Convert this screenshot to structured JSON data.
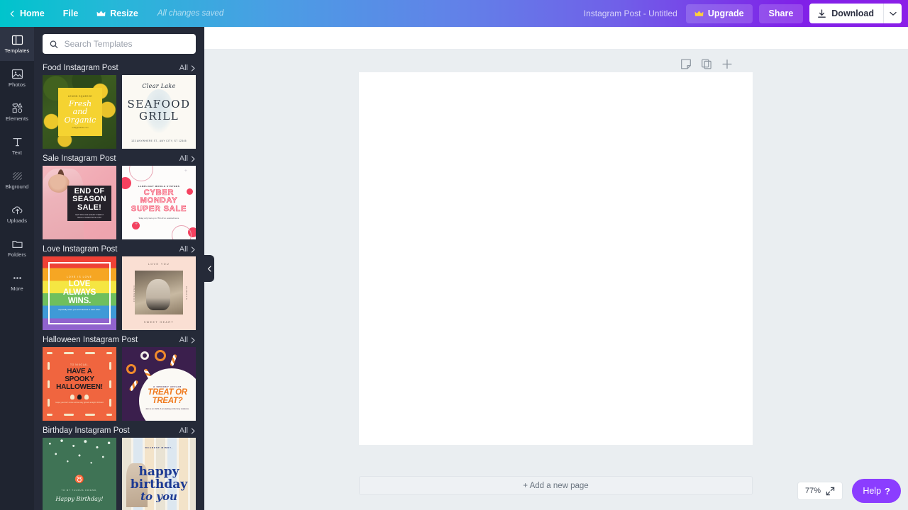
{
  "header": {
    "home_label": "Home",
    "file_label": "File",
    "resize_label": "Resize",
    "saved_status": "All changes saved",
    "doc_title": "Instagram Post - Untitled",
    "upgrade_label": "Upgrade",
    "share_label": "Share",
    "download_label": "Download",
    "gradient_start": "#00c4cc",
    "gradient_end": "#8b1fe8"
  },
  "rail": {
    "items": [
      {
        "label": "Templates",
        "icon": "templates-icon",
        "active": true
      },
      {
        "label": "Photos",
        "icon": "photos-icon",
        "active": false
      },
      {
        "label": "Elements",
        "icon": "elements-icon",
        "active": false
      },
      {
        "label": "Text",
        "icon": "text-icon",
        "active": false
      },
      {
        "label": "Bkground",
        "icon": "background-icon",
        "active": false
      },
      {
        "label": "Uploads",
        "icon": "uploads-icon",
        "active": false
      },
      {
        "label": "Folders",
        "icon": "folders-icon",
        "active": false
      },
      {
        "label": "More",
        "icon": "more-icon",
        "active": false
      }
    ]
  },
  "panel": {
    "search_placeholder": "Search Templates",
    "search_value": "",
    "all_label": "All",
    "sections": [
      {
        "title": "Food Instagram Post",
        "templates": [
          {
            "name": "fresh-and-organic",
            "kicker": "LEMON SQUEEZE",
            "title": "Fresh and Organic",
            "footer": "reallygreatsite.com"
          },
          {
            "name": "seafood-grill",
            "brand": "Clear Lake",
            "line1": "SEAFOOD",
            "line2": "GRILL",
            "address": "123 ANYWHERE ST., ANY CITY, ST 12345"
          }
        ]
      },
      {
        "title": "Sale Instagram Post",
        "templates": [
          {
            "name": "end-of-season-sale",
            "title": "END OF SEASON SALE!",
            "subtitle": "GET 50% OFF EVERY ITEM AT REALLYGREATSITE.COM"
          },
          {
            "name": "cyber-monday-super-sale",
            "kicker": "LAMPLIGHT MOBILE SYSTEMS",
            "title": "CYBER MONDAY SUPER SALE",
            "footer": "Today only! Get up to 75% off on selected items."
          }
        ]
      },
      {
        "title": "Love Instagram Post",
        "templates": [
          {
            "name": "love-always-wins",
            "kicker": "LOVE IS LOVE",
            "title": "LOVE ALWAYS WINS.",
            "footer": "especially when you let it! Be kind to each other."
          },
          {
            "name": "sweet-heart",
            "top": "LOVE YOU",
            "bottom": "SWEET HEART",
            "left": "FOREVER",
            "right": "ALWAYS"
          }
        ]
      },
      {
        "title": "Halloween Instagram Post",
        "templates": [
          {
            "name": "have-a-spooky-halloween",
            "kicker": "TO NIKOLAI,",
            "title": "HAVE A SPOOKY HALLOWEEN!",
            "footer": "Hope you don't come across any ghosts tonight. Richard"
          },
          {
            "name": "treat-or-treat",
            "kicker": "A SPOOKY AFFAIR",
            "title": "TREAT OR TREAT?",
            "footer": "Join us on 10/31, 6 pm starting at the Gray residence."
          }
        ]
      },
      {
        "title": "Birthday Instagram Post",
        "templates": [
          {
            "name": "taurus-birthday",
            "glyph": "♉",
            "kicker": "TO MY TAURUS FRIEND,",
            "title": "Happy Birthday!"
          },
          {
            "name": "happy-birthday-lockers",
            "kicker": "DEAREST MINDY,",
            "line1": "happy",
            "line2": "birthday",
            "line3": "to you"
          }
        ]
      }
    ],
    "collapse_icon": "chevron-left-icon"
  },
  "editor": {
    "page_tools": [
      {
        "name": "add-note-icon",
        "label": "Add note"
      },
      {
        "name": "duplicate-page-icon",
        "label": "Duplicate page"
      },
      {
        "name": "add-page-icon",
        "label": "Add page"
      }
    ],
    "add_page_label": "+ Add a new page",
    "zoom_level": "77%",
    "fullscreen_icon": "expand-icon",
    "help_label": "Help",
    "help_mark": "?",
    "help_color": "#8b3dff"
  }
}
